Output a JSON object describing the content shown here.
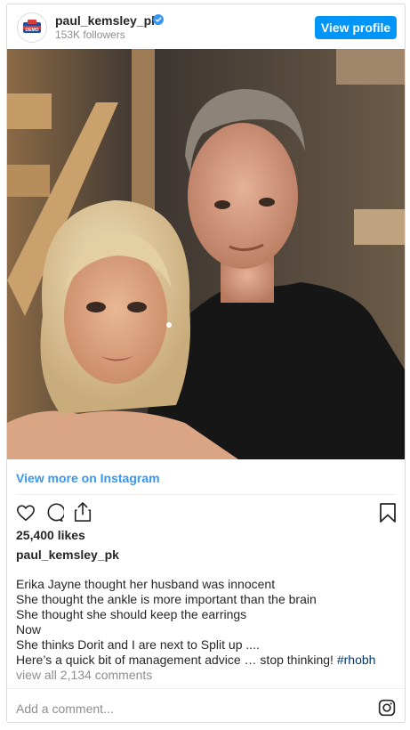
{
  "header": {
    "username": "paul_kemsley_pk",
    "followers": "153K followers",
    "view_profile_label": "View profile",
    "avatar_icon": "profile-avatar"
  },
  "post": {
    "photo_alt": "Photo of a blonde woman and a man in a black suit",
    "view_more_label": "View more on Instagram",
    "likes": "25,400 likes",
    "caption_username": "paul_kemsley_pk",
    "caption_lines": [
      "Erika Jayne thought her husband was innocent",
      "She thought the ankle is more important than the brain",
      "She thought she should keep the earrings",
      "Now",
      "She thinks Dorit and I are next to Split up ....",
      "Here’s a quick bit of management advice … stop thinking! "
    ],
    "hashtag": "#rhobh",
    "view_comments": "view all 2,134 comments",
    "add_comment_placeholder": "Add a comment..."
  },
  "colors": {
    "accent": "#0095f6",
    "link": "#3897f0",
    "hashtag": "#00376b",
    "muted": "#8e8e8e"
  },
  "icons": [
    "heart-icon",
    "comment-icon",
    "share-icon",
    "bookmark-icon",
    "instagram-icon",
    "verified-badge-icon"
  ]
}
